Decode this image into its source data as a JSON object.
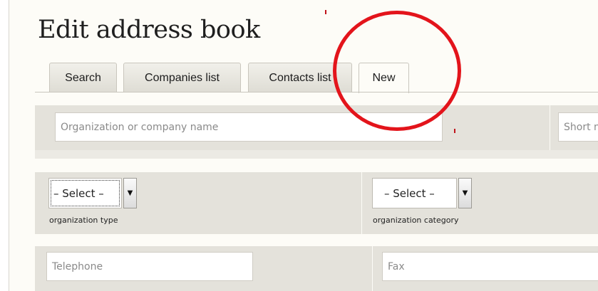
{
  "page": {
    "title": "Edit address book"
  },
  "tabs": [
    {
      "label": "Search",
      "active": false
    },
    {
      "label": "Companies list",
      "active": false
    },
    {
      "label": "Contacts list",
      "active": false
    },
    {
      "label": "New",
      "active": true
    }
  ],
  "form": {
    "org_name_placeholder": "Organization or company name",
    "short_name_placeholder": "Short n",
    "org_type": {
      "selected": "– Select –",
      "caption": "organization type"
    },
    "org_category": {
      "selected": "– Select –",
      "caption": "organization category"
    },
    "telephone_placeholder": "Telephone",
    "fax_placeholder": "Fax"
  },
  "colors": {
    "annotation": "#e3141b",
    "band": "#e4e2db",
    "background": "#fdfcf7"
  }
}
